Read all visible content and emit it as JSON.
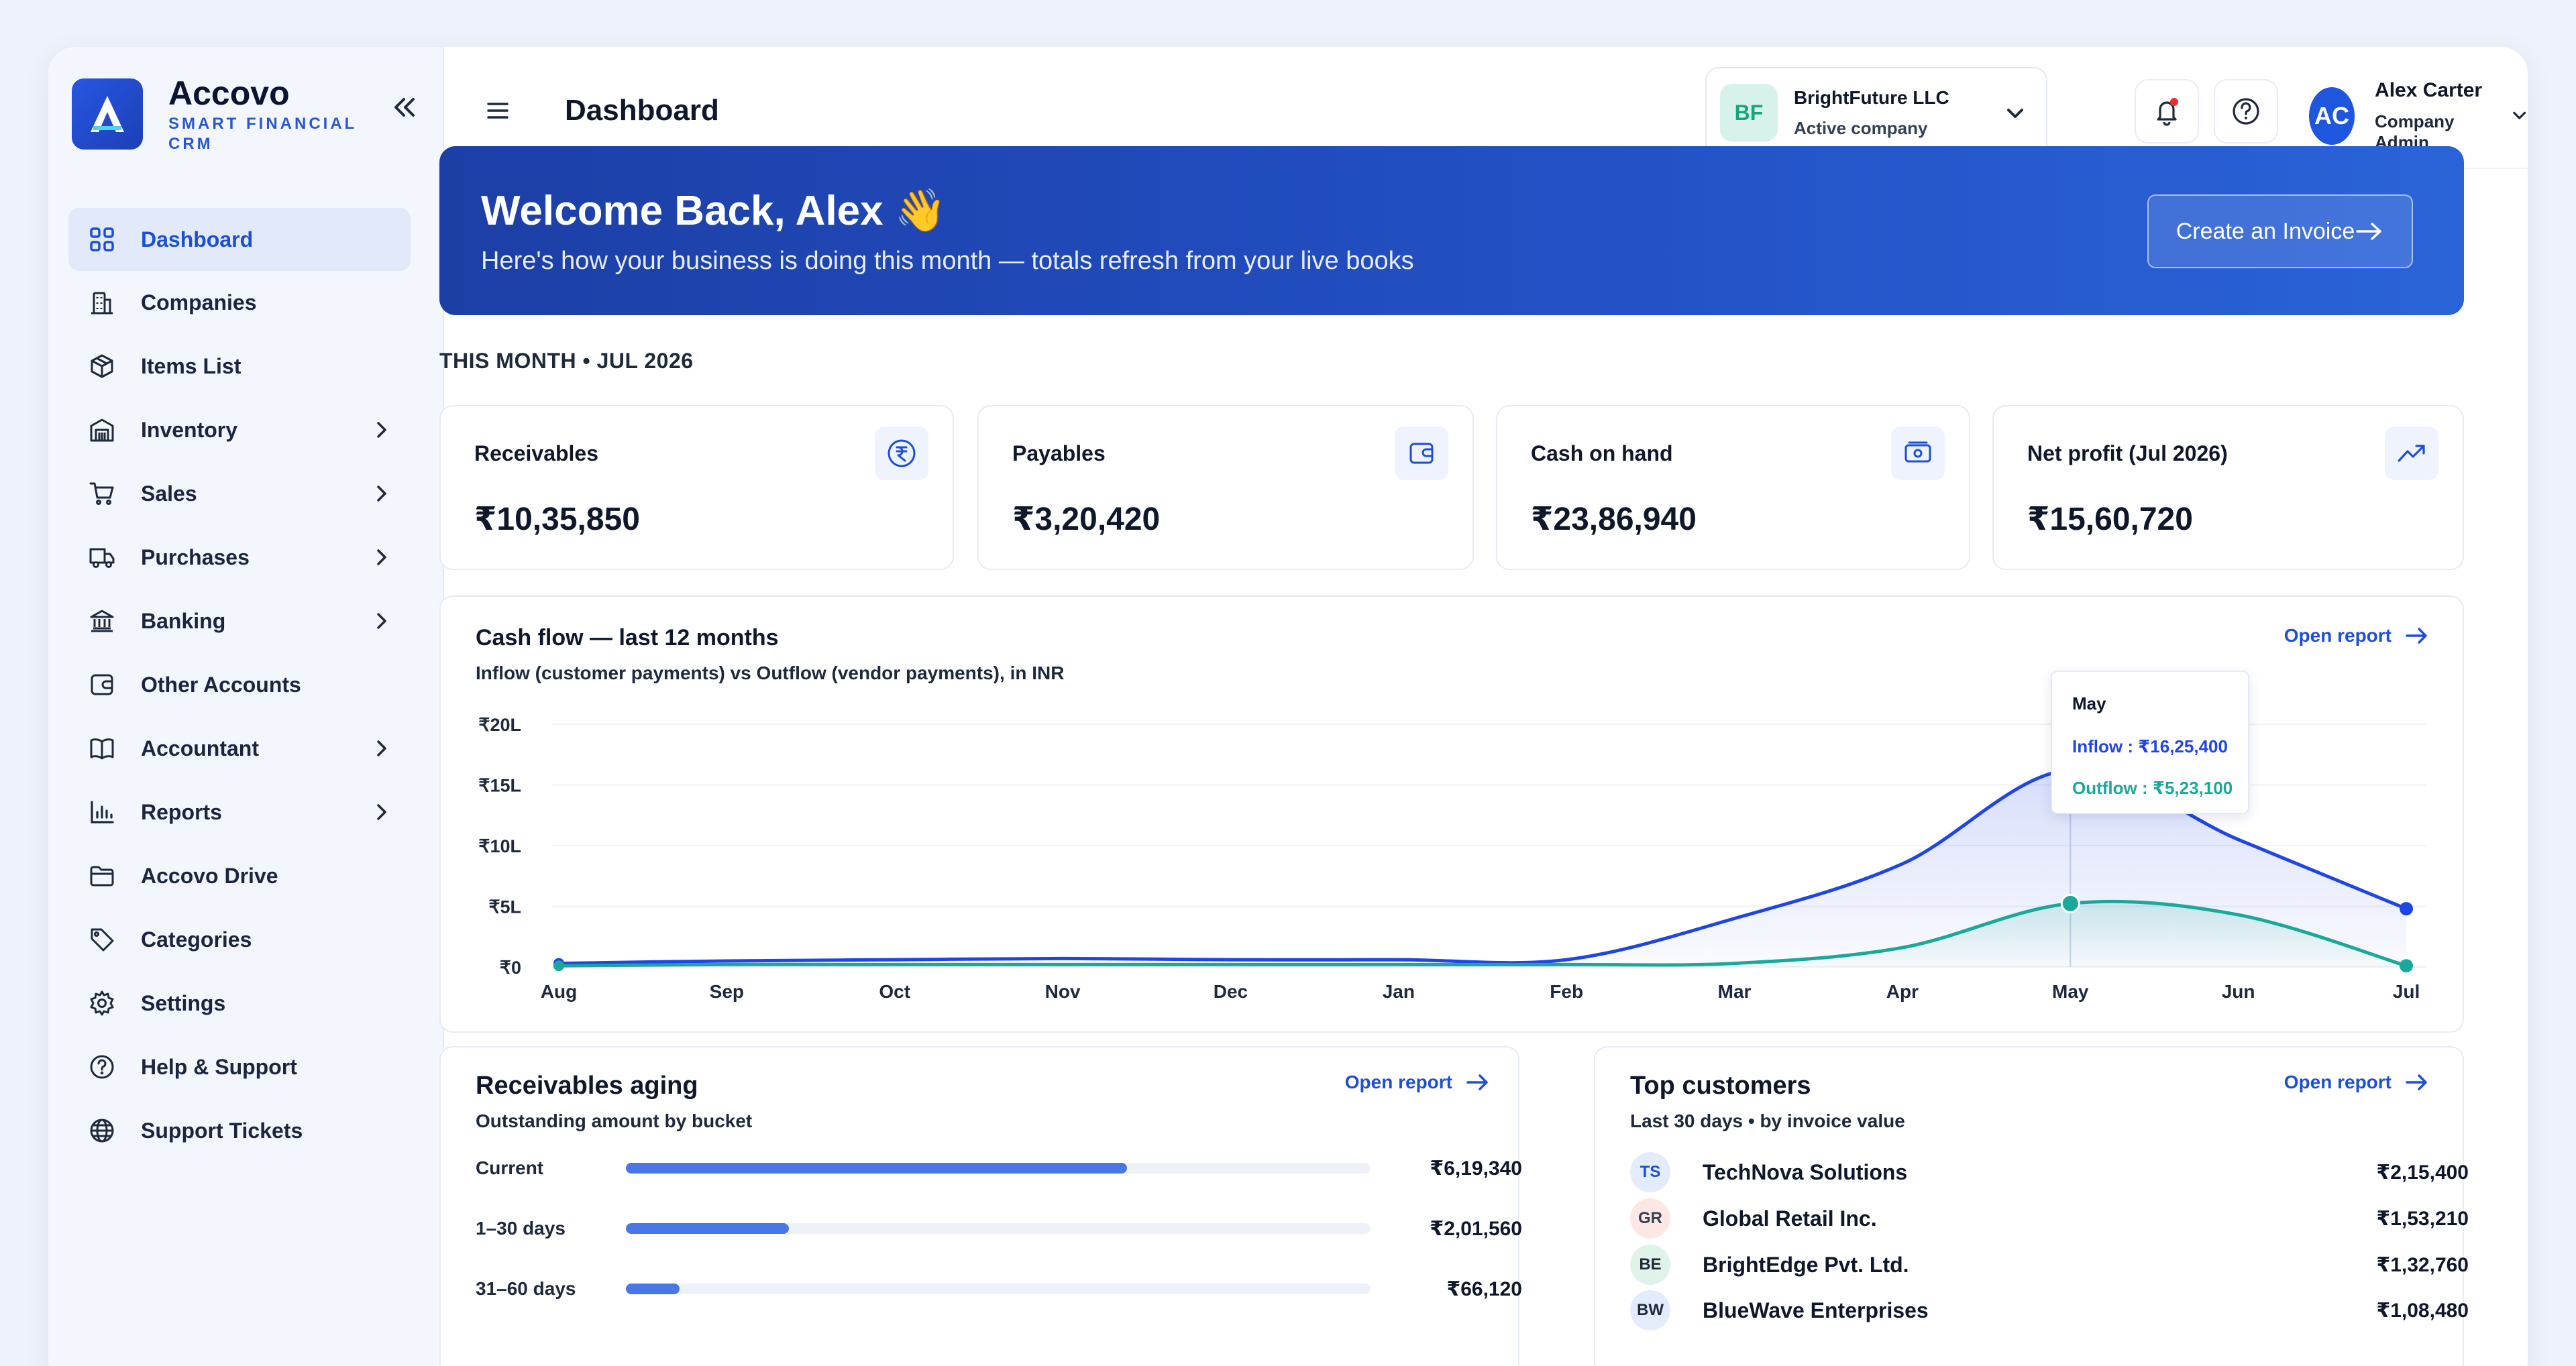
{
  "brand": {
    "name": "Accovo",
    "tagline": "SMART FINANCIAL CRM"
  },
  "sidebar": {
    "items": [
      {
        "label": "Dashboard",
        "icon": "grid-icon",
        "active": true,
        "has_submenu": false
      },
      {
        "label": "Companies",
        "icon": "building-icon",
        "has_submenu": false
      },
      {
        "label": "Items List",
        "icon": "box-icon",
        "has_submenu": false
      },
      {
        "label": "Inventory",
        "icon": "warehouse-icon",
        "has_submenu": true
      },
      {
        "label": "Sales",
        "icon": "cart-icon",
        "has_submenu": true
      },
      {
        "label": "Purchases",
        "icon": "truck-icon",
        "has_submenu": true
      },
      {
        "label": "Banking",
        "icon": "bank-icon",
        "has_submenu": true
      },
      {
        "label": "Other Accounts",
        "icon": "wallet-icon",
        "has_submenu": false
      },
      {
        "label": "Accountant",
        "icon": "book-icon",
        "has_submenu": true
      },
      {
        "label": "Reports",
        "icon": "bar-chart-icon",
        "has_submenu": true
      },
      {
        "label": "Accovo Drive",
        "icon": "folder-icon",
        "has_submenu": false
      },
      {
        "label": "Categories",
        "icon": "tag-icon",
        "has_submenu": false
      },
      {
        "label": "Settings",
        "icon": "gear-icon",
        "has_submenu": false
      },
      {
        "label": "Help & Support",
        "icon": "help-icon",
        "has_submenu": false
      },
      {
        "label": "Support Tickets",
        "icon": "globe-icon",
        "has_submenu": false
      }
    ]
  },
  "header": {
    "title": "Dashboard",
    "company": {
      "initials": "BF",
      "name": "BrightFuture LLC",
      "subtitle": "Active company"
    },
    "user": {
      "initials": "AC",
      "name": "Alex Carter",
      "role": "Company Admin"
    }
  },
  "banner": {
    "title": "Welcome Back, Alex 👋",
    "subtitle": "Here's how your business is doing this month — totals refresh from your live books",
    "button_label": "Create an Invoice"
  },
  "period_label": "THIS MONTH • JUL 2026",
  "kpis": [
    {
      "label": "Receivables",
      "value": "₹10,35,850",
      "icon": "rupee-icon"
    },
    {
      "label": "Payables",
      "value": "₹3,20,420",
      "icon": "wallet-icon"
    },
    {
      "label": "Cash on hand",
      "value": "₹23,86,940",
      "icon": "cash-icon"
    },
    {
      "label": "Net profit (Jul 2026)",
      "value": "₹15,60,720",
      "icon": "trend-up-icon"
    }
  ],
  "cashflow": {
    "title": "Cash flow — last 12 months",
    "subtitle": "Inflow (customer payments) vs Outflow (vendor payments), in INR",
    "open_report": "Open report",
    "tooltip": {
      "month": "May",
      "inflow": "Inflow : ₹16,25,400",
      "outflow": "Outflow : ₹5,23,100"
    }
  },
  "chart_data": {
    "type": "line",
    "x": [
      "Aug",
      "Sep",
      "Oct",
      "Nov",
      "Dec",
      "Jan",
      "Feb",
      "Mar",
      "Apr",
      "May",
      "Jun",
      "Jul"
    ],
    "y_ticks": [
      "₹20L",
      "₹15L",
      "₹10L",
      "₹5L",
      "₹0"
    ],
    "ylim": [
      0,
      20
    ],
    "y_unit": "L",
    "series": [
      {
        "name": "Inflow",
        "color": "#1f45e6",
        "values": [
          0.3,
          0.5,
          0.6,
          0.7,
          0.6,
          0.6,
          0.6,
          4.0,
          8.5,
          16.254,
          10.5,
          4.8
        ]
      },
      {
        "name": "Outflow",
        "color": "#1aa89a",
        "values": [
          0.1,
          0.2,
          0.2,
          0.2,
          0.2,
          0.2,
          0.2,
          0.3,
          1.6,
          5.231,
          4.3,
          0.1
        ]
      }
    ],
    "highlight_index": 9,
    "grid": true
  },
  "aging": {
    "title": "Receivables aging",
    "subtitle": "Outstanding amount by bucket",
    "open_report": "Open report",
    "rows": [
      {
        "label": "Current",
        "amount": "₹6,19,340",
        "value": 619340
      },
      {
        "label": "1–30 days",
        "amount": "₹2,01,560",
        "value": 201560
      },
      {
        "label": "31–60 days",
        "amount": "₹66,120",
        "value": 66120
      }
    ],
    "scale_max": 920000
  },
  "customers": {
    "title": "Top customers",
    "subtitle": "Last 30 days • by invoice value",
    "open_report": "Open report",
    "rows": [
      {
        "initials": "TS",
        "name": "TechNova Solutions",
        "amount": "₹2,15,400",
        "bg": "#e3ecfd",
        "fg": "#1d4fd6"
      },
      {
        "initials": "GR",
        "name": "Global Retail Inc.",
        "amount": "₹1,53,210",
        "bg": "#fde7e4",
        "fg": "#334155"
      },
      {
        "initials": "BE",
        "name": "BrightEdge Pvt. Ltd.",
        "amount": "₹1,32,760",
        "bg": "#dff3ea",
        "fg": "#1f2937"
      },
      {
        "initials": "BW",
        "name": "BlueWave Enterprises",
        "amount": "₹1,08,480",
        "bg": "#e3ecfd",
        "fg": "#1f2937"
      }
    ]
  }
}
